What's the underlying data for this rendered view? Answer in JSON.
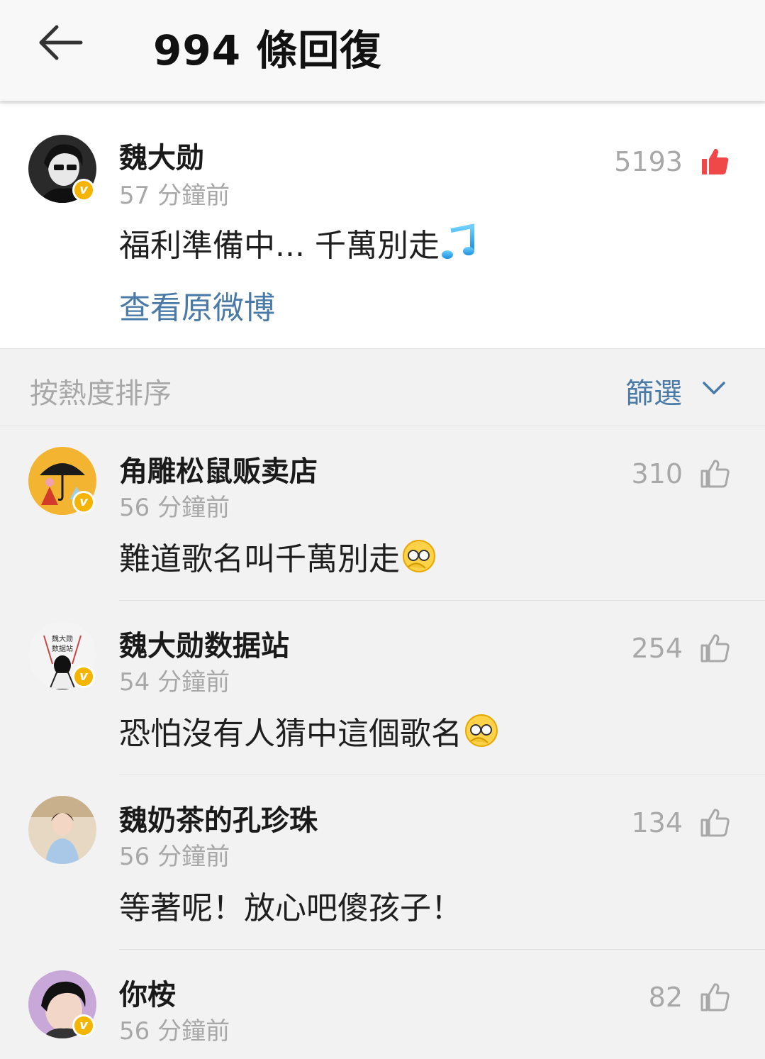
{
  "header": {
    "title": "994 條回復",
    "back_icon": "back-arrow-icon"
  },
  "main_post": {
    "author": "魏大勋",
    "time": "57 分鐘前",
    "text": "福利準備中... 千萬別走",
    "likes": "5193",
    "view_original": "查看原微博",
    "emoji": "music-note-icon"
  },
  "sort": {
    "label": "按熱度排序",
    "filter": "篩選"
  },
  "comments": [
    {
      "author": "角雕松鼠贩卖店",
      "time": "56 分鐘前",
      "text": "難道歌名叫千萬別走",
      "likes": "310",
      "emoji": "facepalm-emoji"
    },
    {
      "author": "魏大勋数据站",
      "time": "54 分鐘前",
      "text": "恐怕沒有人猜中這個歌名",
      "likes": "254",
      "emoji": "facepalm-emoji",
      "avatar_text": [
        "魏大勋",
        "数据站"
      ]
    },
    {
      "author": "魏奶茶的孔珍珠",
      "time": "56 分鐘前",
      "text": "等著呢！放心吧傻孩子！",
      "likes": "134"
    },
    {
      "author": "你桉",
      "time": "56 分鐘前",
      "text": "",
      "likes": "82"
    }
  ],
  "colors": {
    "like_active": "#f04848",
    "link_blue": "#4a7aa8",
    "verified_badge": "#f5b400",
    "muted_text": "#a8a8a8"
  }
}
